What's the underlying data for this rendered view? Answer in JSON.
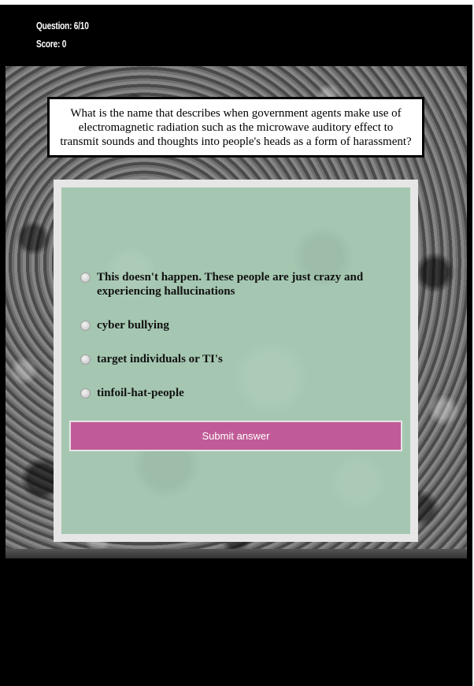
{
  "header": {
    "question_counter": "Question: 6/10",
    "score": "Score: 0"
  },
  "question": {
    "text": "What is the name that describes when government agents make use of electromagnetic radiation such as the microwave auditory effect to transmit sounds and thoughts into people's heads as a form of harassment?"
  },
  "options": [
    {
      "label": "This doesn't happen. These people are just crazy and experiencing hallucinations",
      "selected": false
    },
    {
      "label": "cyber bullying",
      "selected": false
    },
    {
      "label": "target individuals or TI's",
      "selected": false
    },
    {
      "label": "tinfoil-hat-people",
      "selected": false
    }
  ],
  "submit": {
    "label": "Submit answer"
  },
  "colors": {
    "page_background": "#000000",
    "panel_background": "#a5c7b1",
    "panel_border": "#e6e6e6",
    "submit_button": "#c05b97"
  }
}
